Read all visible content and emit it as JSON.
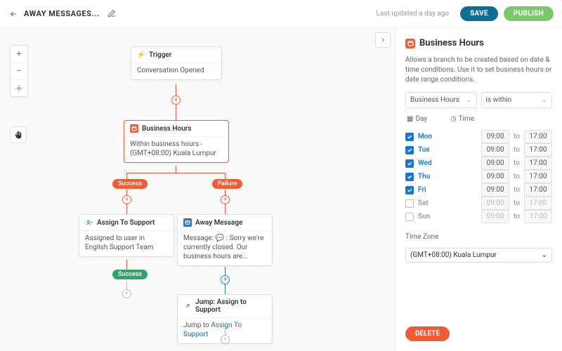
{
  "header": {
    "title": "AWAY MESSAGES...",
    "updated": "Last updated a day ago",
    "save": "SAVE",
    "publish": "PUBLISH"
  },
  "nodes": {
    "trigger": {
      "title": "Trigger",
      "body": "Conversation Opened"
    },
    "hours": {
      "title": "Business Hours",
      "body": "Within business hours - (GMT+08:00) Kuala Lumpur"
    },
    "assign": {
      "title": "Assign To Support",
      "body": "Assigned to user in English Support Team"
    },
    "away": {
      "title": "Away Message",
      "body_prefix": "Message: 💬 : Sorry we're currently closed. Our business hours are..."
    },
    "jump": {
      "title": "Jump: Assign to Support",
      "body_prefix": "Jump to ",
      "body_link": "Assign To Support"
    }
  },
  "branches": {
    "success": "Success",
    "failure": "Failure"
  },
  "panel": {
    "title": "Business Hours",
    "desc": "Allows a branch to be created based on date & time conditions. Use it to set business hours or date range conditions.",
    "select_left": "Business Hours",
    "select_right": "is within",
    "col_day": "Day",
    "col_time": "Time",
    "to_label": "to",
    "days": [
      {
        "name": "Mon",
        "on": true,
        "from": "09:00",
        "to": "17:00"
      },
      {
        "name": "Tue",
        "on": true,
        "from": "09:00",
        "to": "17:00"
      },
      {
        "name": "Wed",
        "on": true,
        "from": "09:00",
        "to": "17:00"
      },
      {
        "name": "Thu",
        "on": true,
        "from": "09:00",
        "to": "17:00"
      },
      {
        "name": "Fri",
        "on": true,
        "from": "09:00",
        "to": "17:00"
      },
      {
        "name": "Sat",
        "on": false,
        "from": "09:00",
        "to": "17:00"
      },
      {
        "name": "Sun",
        "on": false,
        "from": "09:00",
        "to": "17:00"
      }
    ],
    "tz_label": "Time Zone",
    "tz_value": "(GMT+08:00) Kuala Lumpur",
    "delete": "DELETE"
  }
}
